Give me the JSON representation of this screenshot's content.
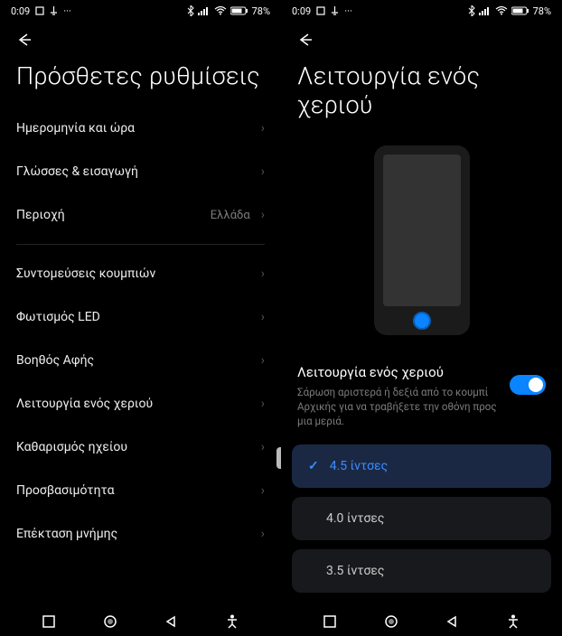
{
  "status": {
    "time": "0:09",
    "battery": "78%"
  },
  "left": {
    "title": "Πρόσθετες ρυθμίσεις",
    "rows": {
      "datetime": "Ημερομηνία και ώρα",
      "languages": "Γλώσσες & εισαγωγή",
      "region": "Περιοχή",
      "region_value": "Ελλάδα",
      "shortcuts": "Συντομεύσεις κουμπιών",
      "led": "Φωτισμός LED",
      "touchassist": "Βοηθός Αφής",
      "onehand": "Λειτουργία ενός χεριού",
      "audioclean": "Καθαρισμός ηχείου",
      "accessibility": "Προσβασιμότητα",
      "memory": "Επέκταση μνήμης"
    }
  },
  "right": {
    "title": "Λειτουργία ενός χεριού",
    "toggle_title": "Λειτουργία ενός χεριού",
    "toggle_desc": "Σάρωση αριστερά ή δεξιά από το κουμπί Αρχικής για να τραβήξετε την οθόνη προς μια μεριά.",
    "options": {
      "o45": "4.5 ίντσες",
      "o40": "4.0 ίντσες",
      "o35": "3.5 ίντσες"
    }
  }
}
